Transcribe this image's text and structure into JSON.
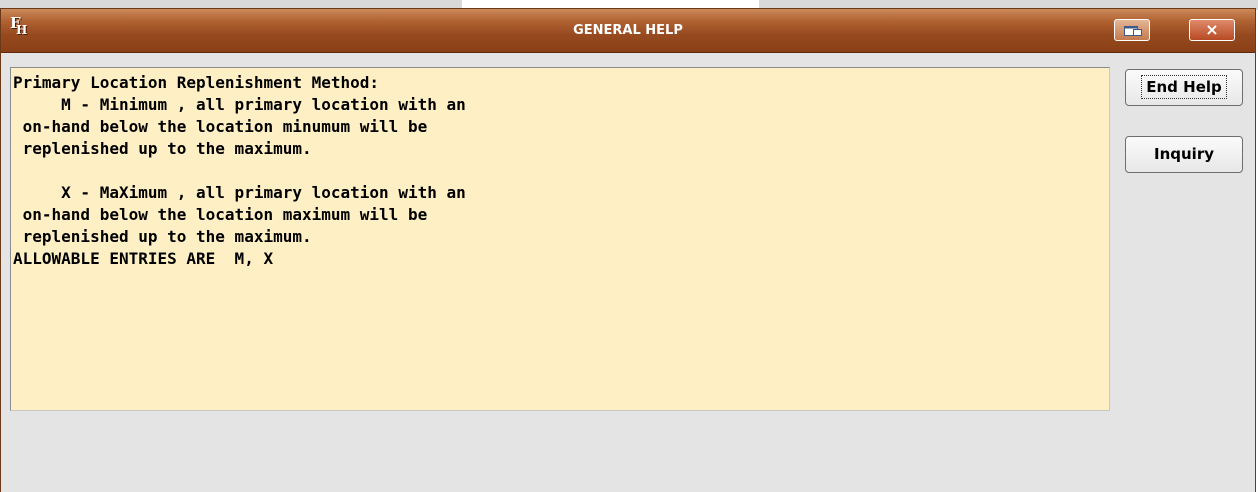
{
  "window": {
    "title": "GENERAL HELP",
    "app_icon": "fh-logo-icon",
    "controls": {
      "restore": "restore-icon",
      "close": "×"
    }
  },
  "help": {
    "lines": [
      "Primary Location Replenishment Method:",
      "     M - Minimum , all primary location with an",
      " on-hand below the location minumum will be",
      " replenished up to the maximum.",
      "",
      "     X - MaXimum , all primary location with an",
      " on-hand below the location maximum will be",
      " replenished up to the maximum.",
      "ALLOWABLE ENTRIES ARE  M, X"
    ]
  },
  "buttons": {
    "end_help": "End Help",
    "inquiry": "Inquiry"
  },
  "colors": {
    "titlebar": "#974a1f",
    "help_background": "#fef0c4",
    "window_background": "#e4e4e4"
  }
}
